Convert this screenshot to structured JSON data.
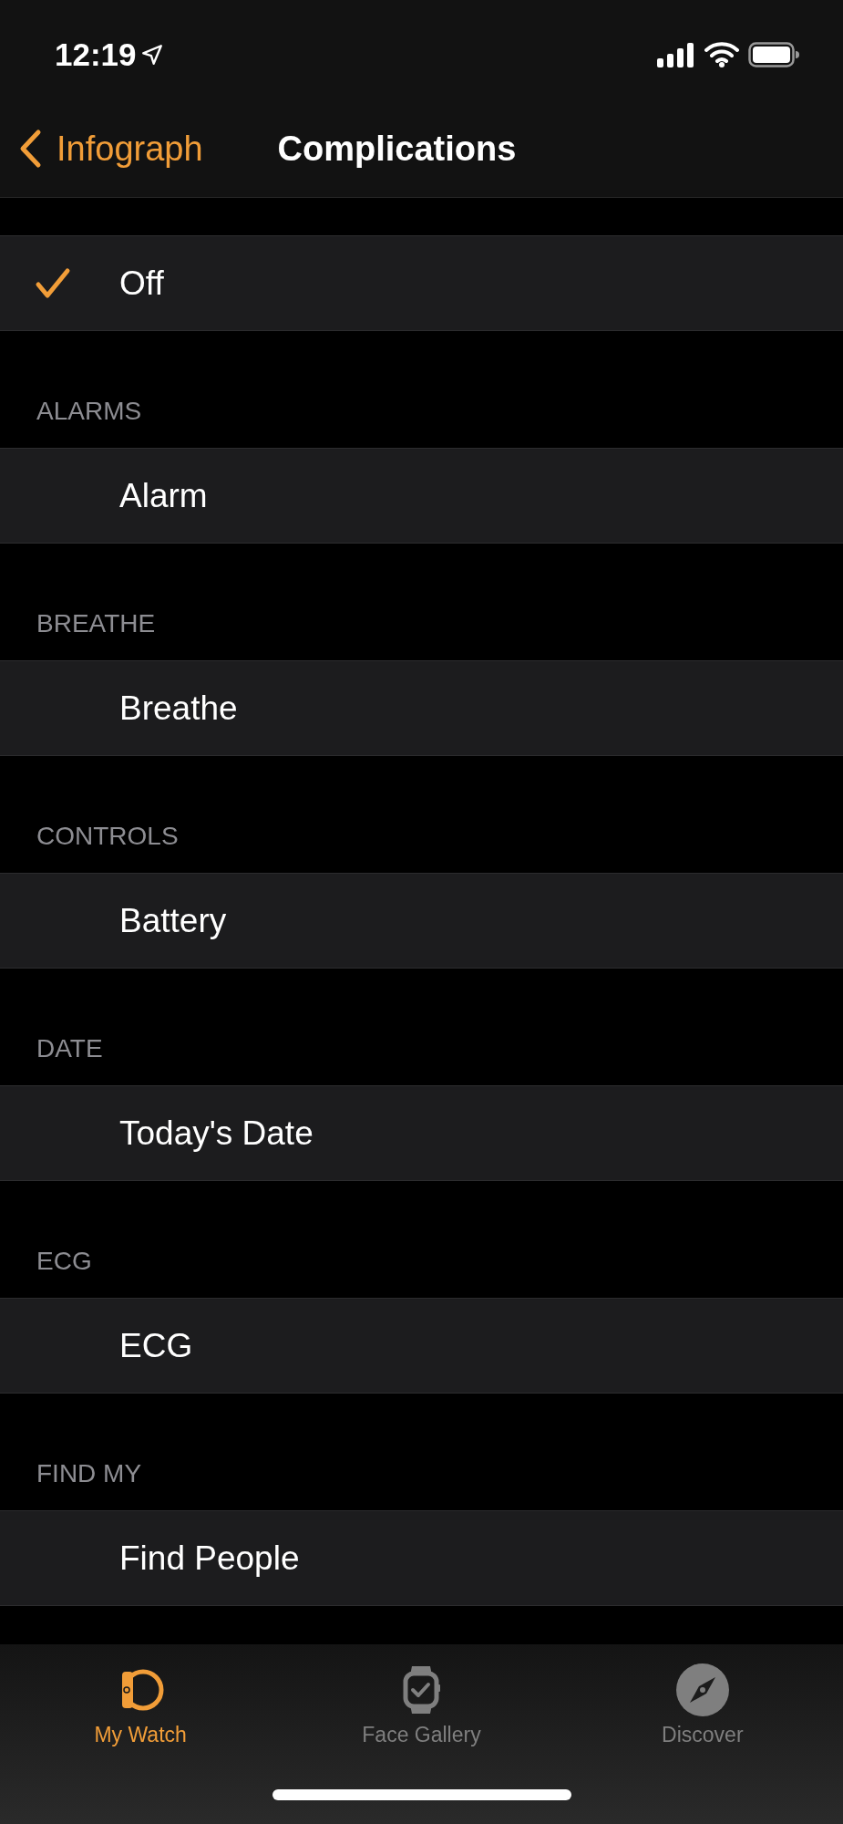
{
  "status_bar": {
    "time": "12:19"
  },
  "nav": {
    "back": "Infograph",
    "title": "Complications"
  },
  "sections": [
    {
      "rows": [
        {
          "label": "Off",
          "selected": true
        }
      ]
    },
    {
      "header": "ALARMS",
      "rows": [
        {
          "label": "Alarm",
          "selected": false
        }
      ]
    },
    {
      "header": "BREATHE",
      "rows": [
        {
          "label": "Breathe",
          "selected": false
        }
      ]
    },
    {
      "header": "CONTROLS",
      "rows": [
        {
          "label": "Battery",
          "selected": false
        }
      ]
    },
    {
      "header": "DATE",
      "rows": [
        {
          "label": "Today's Date",
          "selected": false
        }
      ]
    },
    {
      "header": "ECG",
      "rows": [
        {
          "label": "ECG",
          "selected": false
        }
      ]
    },
    {
      "header": "FIND MY",
      "rows": [
        {
          "label": "Find People",
          "selected": false
        }
      ]
    }
  ],
  "tabs": [
    {
      "label": "My Watch",
      "kind": "watch",
      "selected": true
    },
    {
      "label": "Face Gallery",
      "kind": "gallery",
      "selected": false
    },
    {
      "label": "Discover",
      "kind": "discover",
      "selected": false
    }
  ]
}
